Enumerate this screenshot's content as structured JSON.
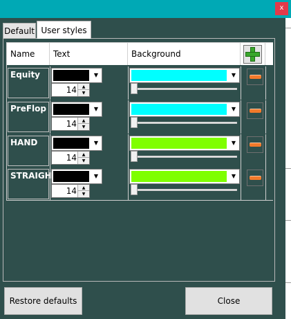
{
  "window": {
    "close_glyph": "x"
  },
  "tabs": [
    {
      "label": "Default",
      "active": false
    },
    {
      "label": "User styles",
      "active": true
    }
  ],
  "table": {
    "headers": [
      "Name",
      "Text",
      "Background"
    ],
    "add_icon": "plus-icon",
    "rows": [
      {
        "name": "Equity",
        "text_color": "#000000",
        "font_size": "14",
        "background_color": "#00ffff",
        "opacity": 0
      },
      {
        "name": "PreFlop",
        "text_color": "#000000",
        "font_size": "14",
        "background_color": "#00ffff",
        "opacity": 0
      },
      {
        "name": "HAND",
        "text_color": "#000000",
        "font_size": "14",
        "background_color": "#7fff00",
        "opacity": 0
      },
      {
        "name": "STRAIGHT",
        "text_color": "#000000",
        "font_size": "14",
        "background_color": "#7fff00",
        "opacity": 0
      }
    ],
    "remove_icon": "minus-icon"
  },
  "buttons": {
    "restore": "Restore defaults",
    "close": "Close"
  },
  "colors": {
    "window_bg": "#2f4f4c",
    "titlebar": "#00a9b5",
    "close_button": "#e33a4a",
    "accent_add": "#3aa72c",
    "accent_remove": "#f27a2b"
  }
}
